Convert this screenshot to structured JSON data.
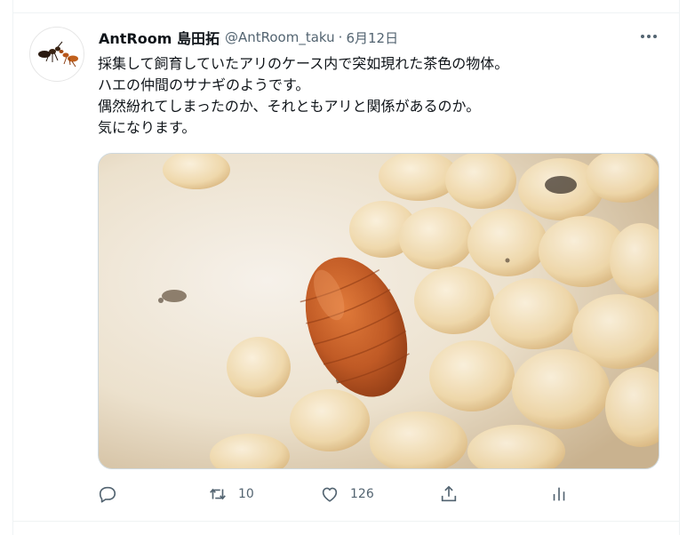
{
  "tweet": {
    "display_name": "AntRoom 島田拓",
    "handle": "@AntRoom_taku",
    "separator": "·",
    "date": "6月12日",
    "text_lines": [
      "採集して飼育していたアリのケース内で突如現れた茶色の物体。",
      "ハエの仲間のサナギのようです。",
      "偶然紛れてしまったのか、それともアリと関係があるのか。",
      "気になります。"
    ]
  },
  "actions": {
    "reply": {
      "icon": "reply-icon",
      "count": ""
    },
    "retweet": {
      "icon": "retweet-icon",
      "count": "10"
    },
    "like": {
      "icon": "heart-icon",
      "count": "126"
    },
    "share": {
      "icon": "share-icon"
    },
    "analytics": {
      "icon": "analytics-icon"
    }
  },
  "colors": {
    "text": "#0f1419",
    "secondary": "#536471",
    "border": "#eff3f4",
    "pupa": "#c4602a",
    "larvae": "#f2dfb8"
  }
}
